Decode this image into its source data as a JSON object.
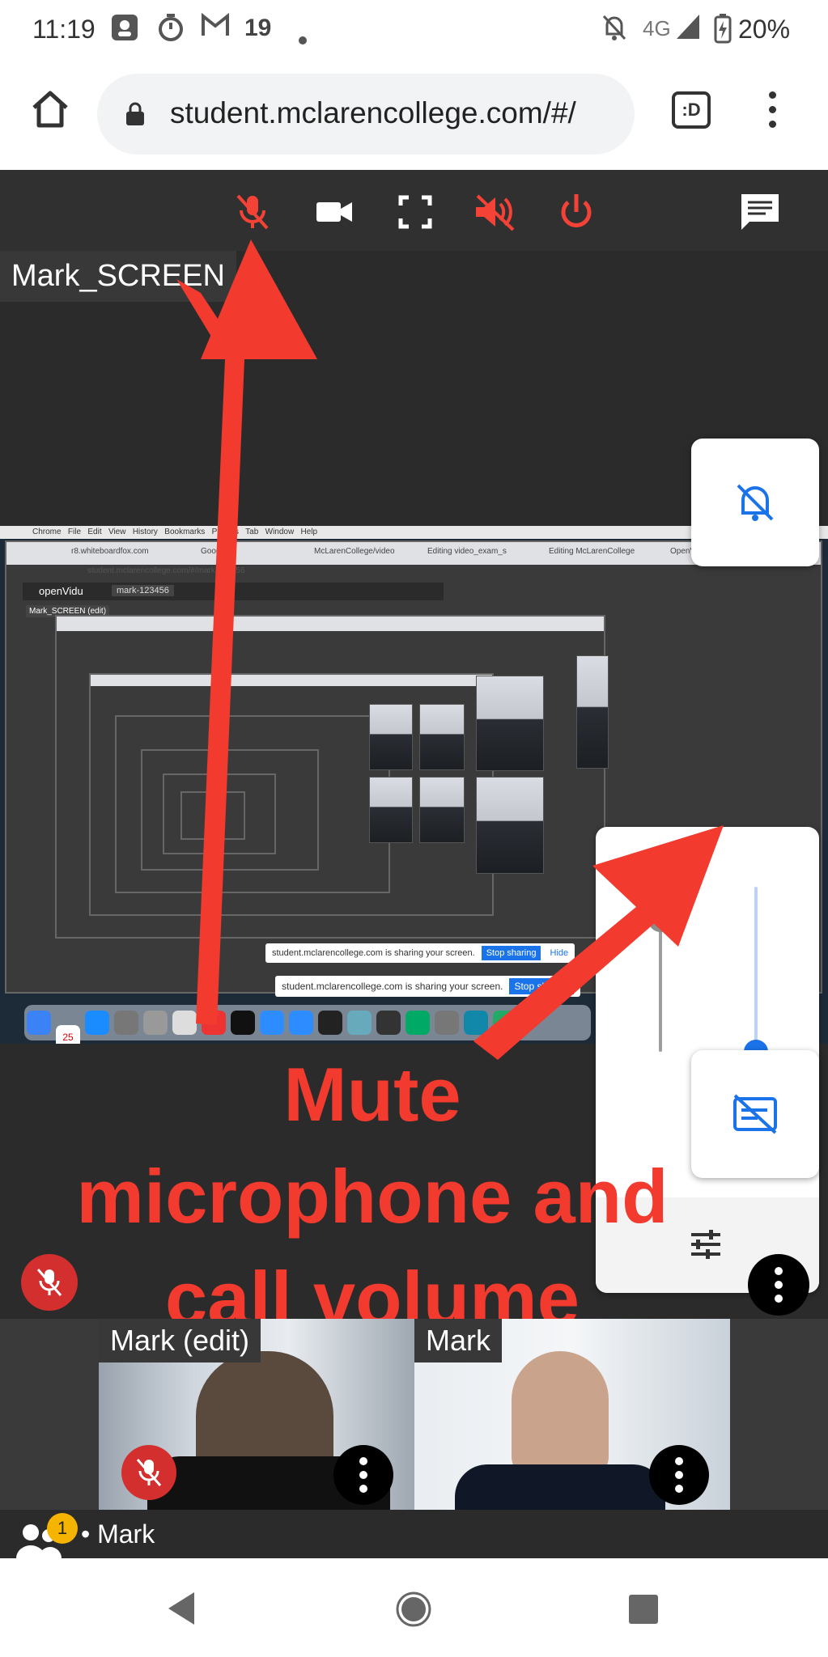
{
  "status_bar": {
    "time": "11:19",
    "notification_count": "19",
    "network": "4G",
    "battery": "20%",
    "icons": [
      "gallery-icon",
      "timer-icon",
      "gmail-icon",
      "dot-icon",
      "bell-off-icon",
      "signal-icon",
      "battery-charging-icon"
    ]
  },
  "browser": {
    "url": "student.mclarencollege.com/#/",
    "tab_label": ":D"
  },
  "toolbar": {
    "icons": [
      "mic-off-icon",
      "videocam-icon",
      "fullscreen-icon",
      "volume-off-icon",
      "power-icon",
      "chat-icon"
    ],
    "accent_red": "#f44336",
    "text_white": "#ffffff"
  },
  "main": {
    "screen_name": "Mark_SCREEN",
    "shared_screen": {
      "app_name": "openVidu",
      "session": "mark-123456",
      "inner_name": "Mark_SCREEN (edit)",
      "share_notice": "student.mclarencollege.com is sharing your screen.",
      "stop_label": "Stop sharing",
      "hide_label": "Hide",
      "menu_items": [
        "Chrome",
        "File",
        "Edit",
        "View",
        "History",
        "Bookmarks",
        "Profiles",
        "Tab",
        "Window",
        "Help"
      ],
      "tabs": [
        "r8.whiteboardfox.com",
        "Google",
        "McLarenCollege/video",
        "Editing video_exam_s",
        "Editing McLarenCollege",
        "OpenVidu"
      ],
      "inner_url": "student.mclarencollege.com/#/mark-123456",
      "calendar_day": "25"
    }
  },
  "volume_panel": {
    "mic_level": 0.8,
    "call_volume_level": 0.0,
    "slider_color": "#1a73e8"
  },
  "annotation": {
    "lines": [
      "Mute",
      "microphone and",
      "call volume"
    ],
    "color": "#f23a2e"
  },
  "participants": [
    {
      "name": "Mark (edit)",
      "muted": true
    },
    {
      "name": "Mark",
      "muted": false
    }
  ],
  "people_bar": {
    "count_badge": "1",
    "label": "• Mark"
  }
}
